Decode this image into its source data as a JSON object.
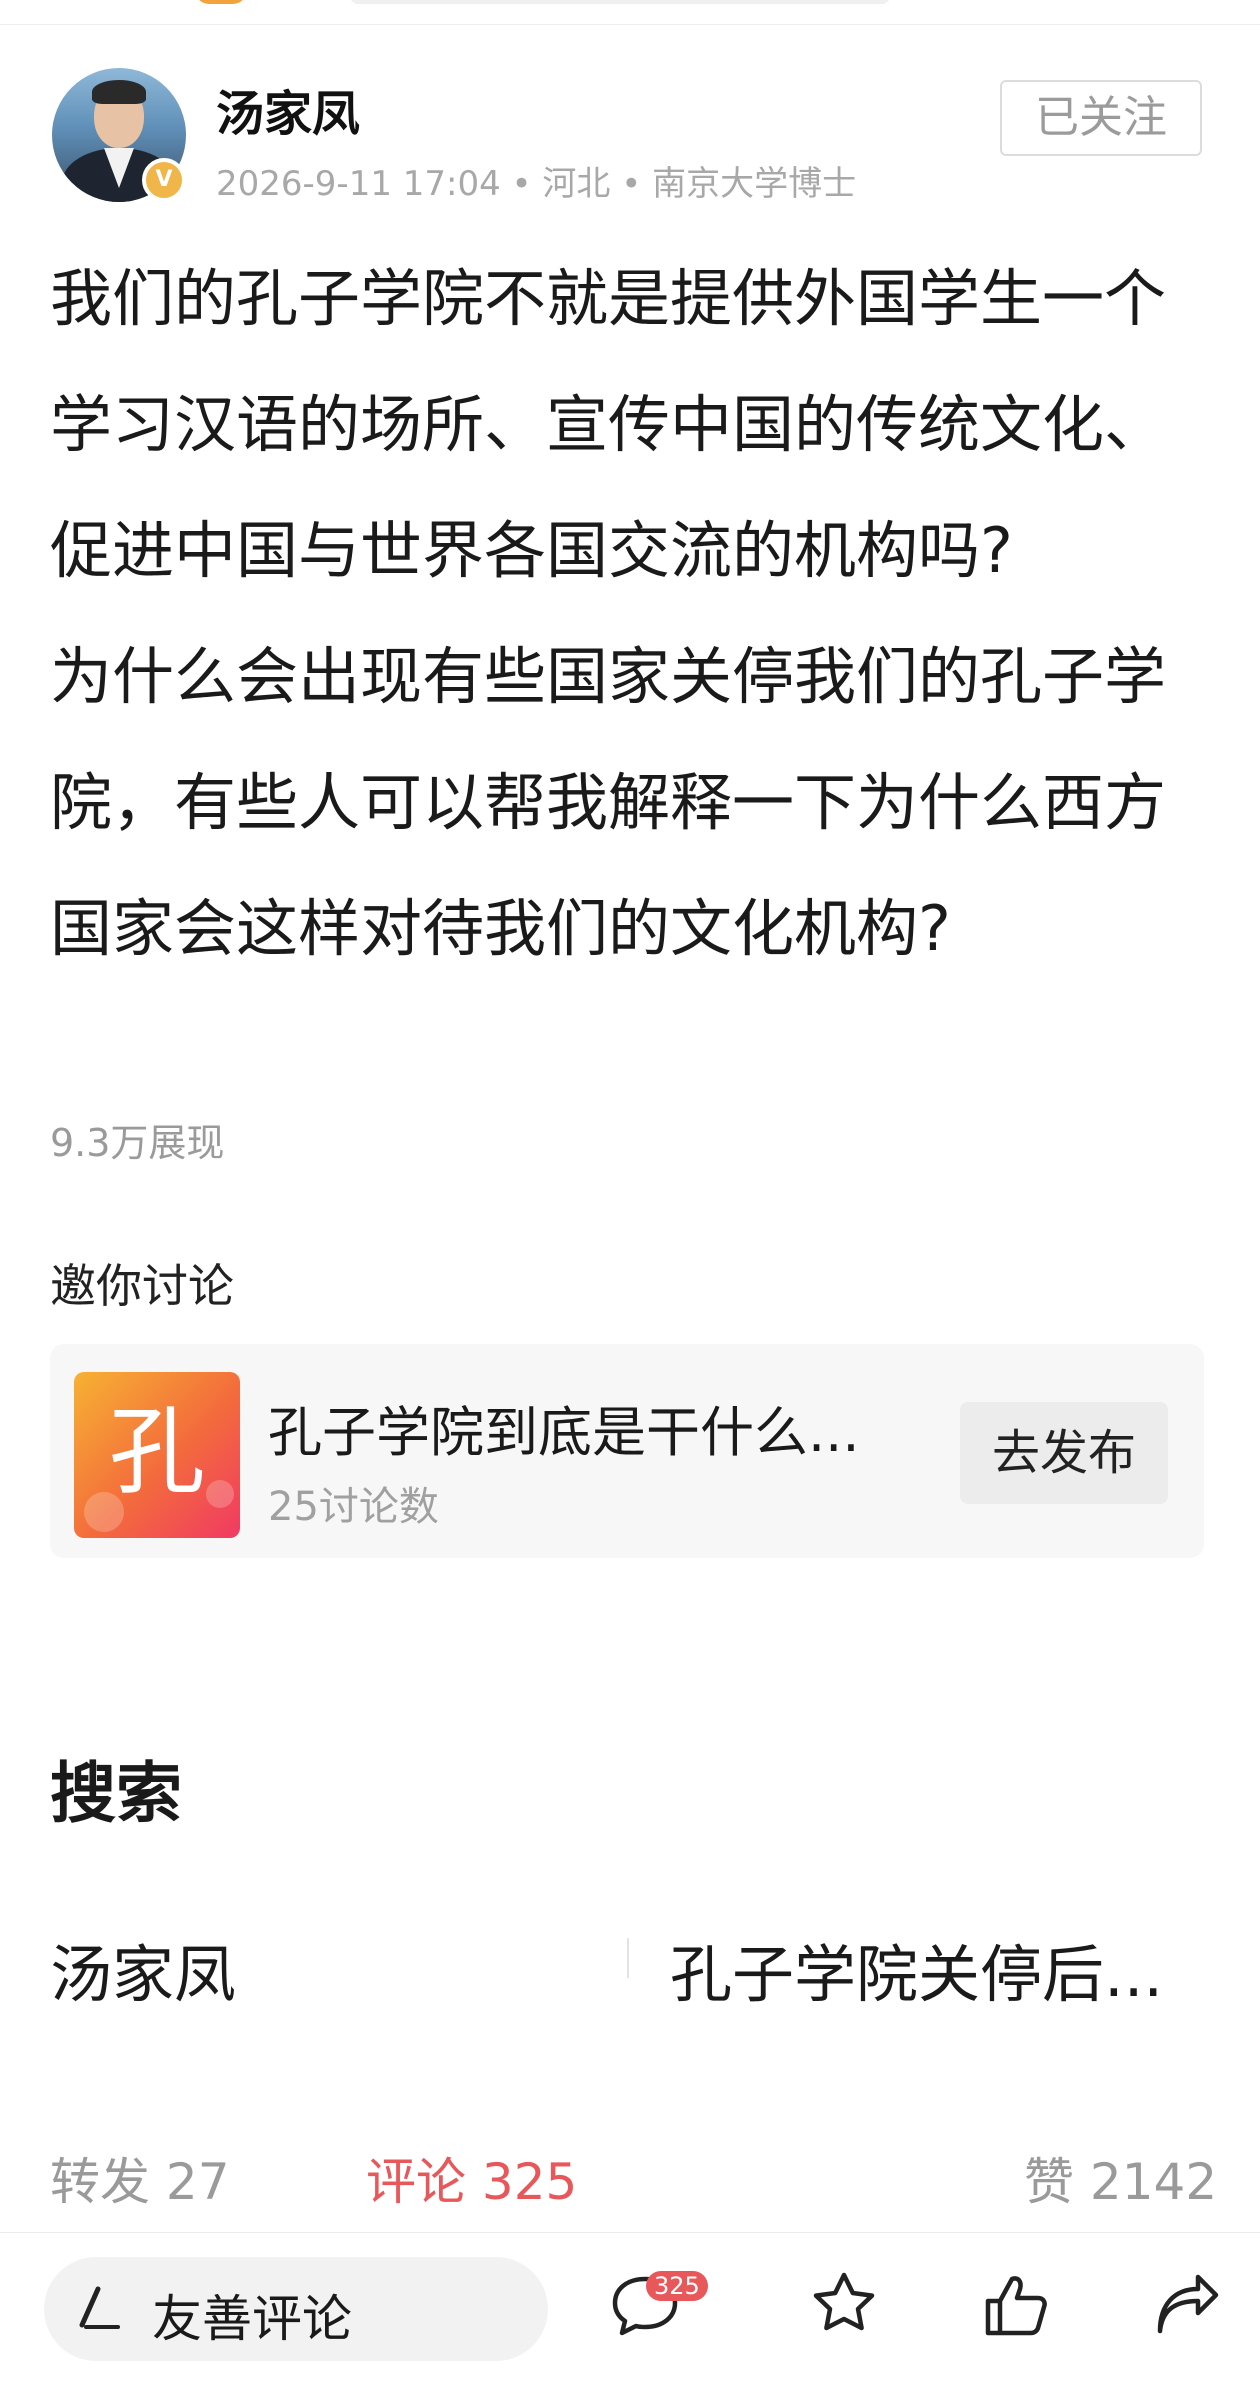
{
  "author": {
    "name": "汤家凤",
    "meta": "2026-9-11 17:04 • 河北 • 南京大学博士",
    "verified_badge": "V",
    "follow_label": "已关注"
  },
  "post": {
    "paragraphs": [
      "我们的孔子学院不就是提供外国学生一个学习汉语的场所、宣传中国的传统文化、促进中国与世界各国交流的机构吗?",
      "为什么会出现有些国家关停我们的孔子学院，有些人可以帮我解释一下为什么西方国家会这样对待我们的文化机构?"
    ],
    "views": "9.3万展现"
  },
  "invite": {
    "title": "邀你讨论",
    "topic_icon_char": "孔",
    "topic_title": "孔子学院到底是干什么...",
    "topic_count": "25讨论数",
    "publish_label": "去发布"
  },
  "search": {
    "title": "搜索",
    "left_term": "汤家凤",
    "right_term": "孔子学院关停后..."
  },
  "stats": {
    "repost": "转发 27",
    "comments": "评论 325",
    "likes": "赞 2142"
  },
  "bottom_bar": {
    "comment_placeholder": "友善评论",
    "comment_badge": "325",
    "icons": [
      "pen-icon",
      "comment-icon",
      "star-icon",
      "thumbs-up-icon",
      "share-icon"
    ]
  },
  "colors": {
    "accent_red": "#e8585b",
    "badge_gold": "#f0b64a",
    "muted_text": "#9a9a9a"
  }
}
